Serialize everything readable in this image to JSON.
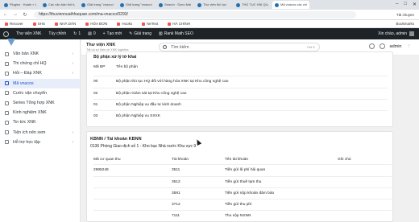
{
  "browser": {
    "tabs": [
      {
        "title": "Plugins · Hoale » WordPress"
      },
      {
        "title": "Các văn bản thủ tục đường sắt"
      },
      {
        "title": "Giải trang \"vnacco\" · thuvien"
      },
      {
        "title": "Giải trang \"vnacco\" · Search"
      },
      {
        "title": "Search · Sono Mail"
      },
      {
        "title": "Thư viện thủ tục"
      },
      {
        "title": "THỦ TỤC HẢI QUAN"
      },
      {
        "title": "Mã vnacos các chi cục Hải quan"
      }
    ],
    "url": "https://thuviennuathhaquan.com/ma-vnacco/0293/",
    "extensions_label": "Tải chuyen",
    "bookmarks": [
      {
        "label": "Recover"
      },
      {
        "label": "SHS"
      },
      {
        "label": "NHÀ DÂN"
      },
      {
        "label": "HÓA ĐƠN"
      },
      {
        "label": "Hooks"
      },
      {
        "label": "NeText"
      },
      {
        "label": "HÀ CHÍNH"
      }
    ],
    "bookmarks_right": "Bookmarks"
  },
  "adminbar": {
    "site": "Thư viện XNK",
    "customize": "Tùy chỉnh",
    "updates": "1",
    "comments": "0",
    "new": "Tạo mới",
    "edit": "Giải trang",
    "rank_math": "Rank Math SEO",
    "greeting": "Xin chào, admin"
  },
  "sidebar": {
    "items": [
      {
        "label": "Văn bản XNK"
      },
      {
        "label": "Thi chứng chỉ HQ"
      },
      {
        "label": "Hỏi – Đáp XNK"
      },
      {
        "label": "Mã vnacos"
      },
      {
        "label": "Cước vận chuyển"
      },
      {
        "label": "Series Tổng hợp XNK"
      },
      {
        "label": "Kinh nghiệm XNK"
      },
      {
        "label": "Tin tức XNK"
      },
      {
        "label": "Tiện ích nên xem"
      },
      {
        "label": "Hỗ trợ học tập"
      }
    ]
  },
  "header": {
    "title": "Thư viện XNK",
    "subtitle": "Tất cả sự kiện về XNK logistics",
    "search_placeholder": "Tìm kiếm",
    "search_shortcut": "Ctrl K",
    "user": "admin"
  },
  "card1": {
    "title": "Bộ phận xử lý tờ khai",
    "columns": {
      "code": "Mã BP",
      "name": "Tên bộ phận"
    },
    "rows": [
      {
        "code": "00",
        "name": "Bộ phận thủ tục HQ đối với hàng hóa XNK tại Khu công nghệ cao"
      },
      {
        "code": "02",
        "name": "Bộ phận Giám sát tại Khu công nghệ cao"
      },
      {
        "code": "01",
        "name": "Bộ phận Nghiệp vụ đầu tư kinh doanh"
      },
      {
        "code": "03",
        "name": "Bộ phận Nghiệp vụ SXXK"
      }
    ]
  },
  "card2": {
    "title": "KBNN / Tài khoản KBNN",
    "subtitle": "0136 Phòng Giao dịch số 1 - Kho bạc Nhà nước Khu vực 9",
    "columns": {
      "agency": "Mã cơ quan thu",
      "account": "Tài khoản",
      "account_name": "Tên tài khoản",
      "note": "Ghi chú"
    },
    "rows": [
      {
        "agency": "2995248",
        "account": "3511",
        "account_name": "Tiền gửi lệ phí hải quan",
        "note": ""
      },
      {
        "agency": "",
        "account": "3512",
        "account_name": "Tiền gửi thuế tạm thu",
        "note": ""
      },
      {
        "agency": "",
        "account": "3591",
        "account_name": "Tiền gửi nộp khoản đảm bảo",
        "note": ""
      },
      {
        "agency": "",
        "account": "3712",
        "account_name": "Tiền gửi thu phí",
        "note": ""
      },
      {
        "agency": "",
        "account": "7111",
        "account_name": "Thu nộp NSNN",
        "note": ""
      }
    ]
  }
}
